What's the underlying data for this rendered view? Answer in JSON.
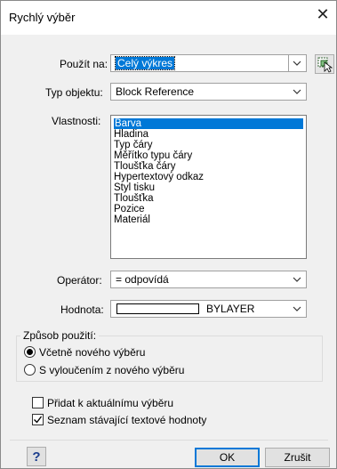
{
  "window": {
    "title": "Rychlý výběr",
    "close_symbol": "✕"
  },
  "apply_to": {
    "label": "Použít na:",
    "value": "Celý výkres"
  },
  "object_type": {
    "label": "Typ objektu:",
    "value": "Block Reference"
  },
  "properties": {
    "label": "Vlastnosti:",
    "items": [
      "Barva",
      "Hladina",
      "Typ čáry",
      "Měřítko typu čáry",
      "Tloušťka čáry",
      "Hypertextový odkaz",
      "Styl tisku",
      "Tloušťka",
      "Pozice",
      "Materiál"
    ],
    "selected": "Barva"
  },
  "operator": {
    "label": "Operátor:",
    "value": "= odpovídá"
  },
  "value_field": {
    "label": "Hodnota:",
    "value": "BYLAYER"
  },
  "application_mode": {
    "title": "Způsob použití:",
    "include": "Včetně nového výběru",
    "exclude": "S vyloučením z nového výběru",
    "selected": "include"
  },
  "append_to_selection": {
    "label": "Přidat k aktuálnímu výběru",
    "checked": false
  },
  "existing_text_values": {
    "label": "Seznam stávající textové hodnoty",
    "checked": true
  },
  "buttons": {
    "help": "?",
    "ok": "OK",
    "cancel": "Zrušit"
  },
  "colors": {
    "accent": "#0078d7",
    "dialog_bg": "#f0f0f0"
  }
}
